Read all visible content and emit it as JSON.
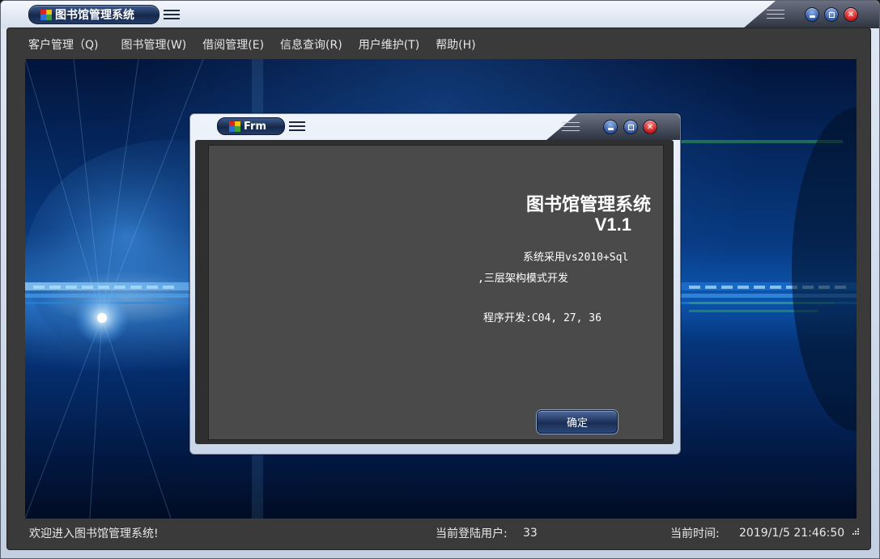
{
  "window": {
    "title": "图书馆管理系统"
  },
  "menu": [
    {
      "label": "客户管理（Q)"
    },
    {
      "label": "图书管理(W)"
    },
    {
      "label": "借阅管理(E)"
    },
    {
      "label": "信息查询(R)"
    },
    {
      "label": "用户维护(T)"
    },
    {
      "label": "帮助(H)"
    }
  ],
  "status": {
    "welcome": "欢迎进入图书馆管理系统!",
    "users_label": "当前登陆用户:",
    "users_value": "33",
    "time_label": "当前时间:",
    "time_value": "2019/1/5 21:46:50"
  },
  "dialog": {
    "title": "Frm",
    "about_title": "图书馆管理系统",
    "version": "V1.1",
    "line1": "系统采用vs2010+Sql",
    "line2": ",三层架构模式开发",
    "line3": "程序开发:C04, 27, 36",
    "ok_label": "确定"
  },
  "icons": {
    "app": "app-logo-icon",
    "menu": "hamburger-menu-icon",
    "minimize": "minimize-icon",
    "maximize": "maximize-icon",
    "close": "close-icon",
    "resize": "resize-grip-icon"
  },
  "colors": {
    "pill": "#15284a",
    "close": "#c81818",
    "control": "#2f579f",
    "frame": "#3a3a3a",
    "dialog_body": "#4a4a4a"
  }
}
